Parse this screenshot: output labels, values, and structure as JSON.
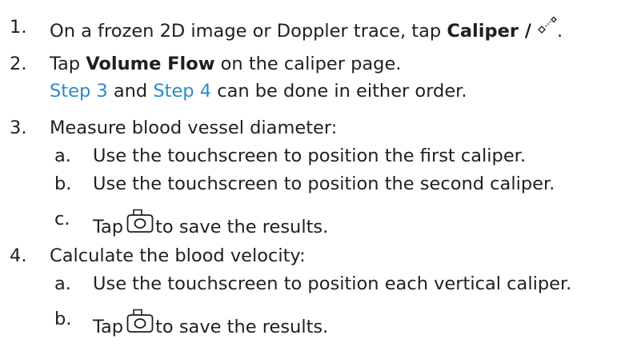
{
  "steps": [
    {
      "number": "1.",
      "text_before": "On a frozen 2D image or Doppler trace, tap ",
      "bold": "Caliper /",
      "text_after": "."
    },
    {
      "number": "2.",
      "text_before": "Tap ",
      "bold": "Volume Flow",
      "text_after": " on the caliper page.",
      "note_link1": "Step 3",
      "note_mid": " and ",
      "note_link2": "Step 4",
      "note_end": " can be done in either order."
    },
    {
      "number": "3.",
      "text": "Measure blood vessel diameter:",
      "substeps": [
        {
          "letter": "a.",
          "text": "Use the touchscreen to position the first caliper."
        },
        {
          "letter": "b.",
          "text": "Use the touchscreen to position the second caliper."
        },
        {
          "letter": "c.",
          "text_before": "Tap",
          "text_after": "to save the results."
        }
      ]
    },
    {
      "number": "4.",
      "text": "Calculate the blood velocity:",
      "substeps": [
        {
          "letter": "a.",
          "text": "Use the touchscreen to position each vertical caliper."
        },
        {
          "letter": "b.",
          "text_before": "Tap",
          "text_after": "to save the results."
        }
      ]
    }
  ],
  "icons": {
    "caliper": "caliper-icon",
    "camera": "camera-icon"
  },
  "colors": {
    "text": "#1f1f1f",
    "link": "#2a8bc4"
  }
}
